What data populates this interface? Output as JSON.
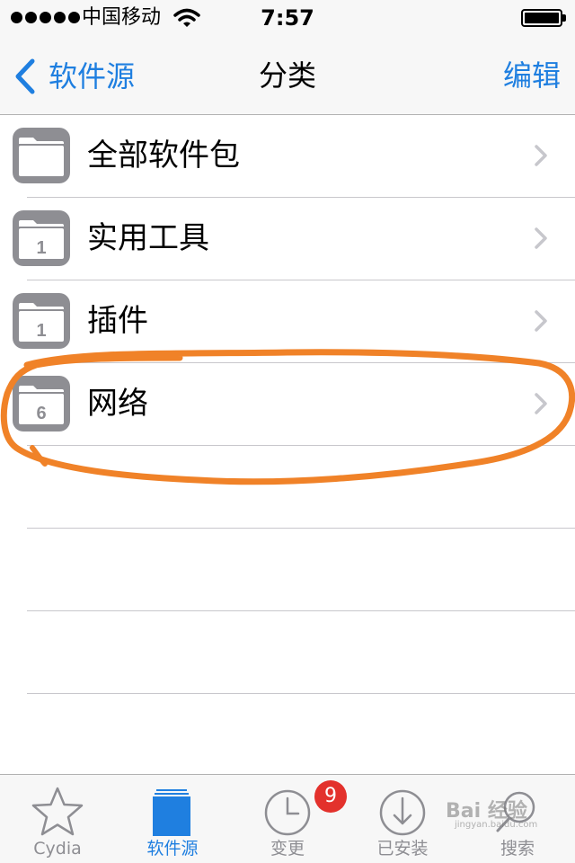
{
  "status_bar": {
    "carrier": "中国移动",
    "time": "7:57"
  },
  "nav": {
    "back_label": "软件源",
    "title": "分类",
    "edit_label": "编辑"
  },
  "rows": [
    {
      "label": "全部软件包",
      "count": ""
    },
    {
      "label": "实用工具",
      "count": "1"
    },
    {
      "label": "插件",
      "count": "1"
    },
    {
      "label": "网络",
      "count": "6"
    }
  ],
  "tabs": [
    {
      "label": "Cydia",
      "icon": "star-icon"
    },
    {
      "label": "软件源",
      "icon": "sources-icon",
      "active": true
    },
    {
      "label": "变更",
      "icon": "clock-icon"
    },
    {
      "label": "已安装",
      "icon": "download-icon"
    },
    {
      "label": "搜索",
      "icon": "search-icon"
    }
  ],
  "badge": {
    "count": "9"
  },
  "watermark": {
    "text": "Bai 经验",
    "sub": "jingyan.baidu.com"
  },
  "colors": {
    "accent": "#1f7fe0",
    "annotation": "#f08228",
    "badge": "#e3312c"
  }
}
